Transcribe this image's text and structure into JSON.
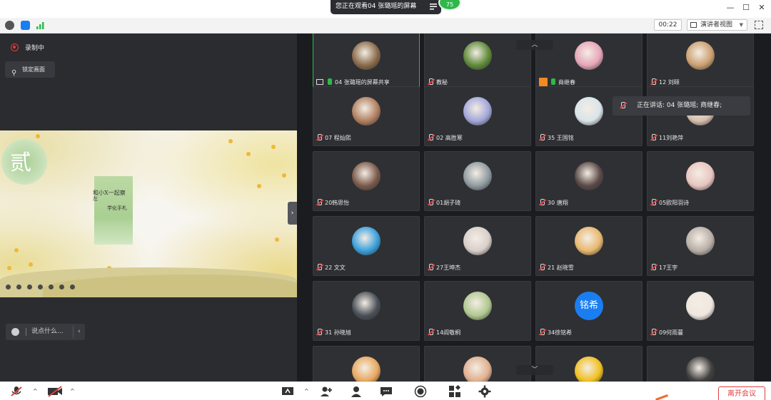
{
  "titlebar": {
    "share_banner": "您正在观看04 张璐瑶的屏幕",
    "participant_count": "75",
    "min": "—",
    "max": "☐",
    "close": "✕"
  },
  "toolbar": {
    "timer": "00:22",
    "view_mode": "演讲者视图",
    "view_caret": "▼"
  },
  "left": {
    "recording_label": "录制中",
    "lock_label": "锁定画面",
    "chat_placeholder": "说点什么...",
    "chat_arrow": "‹",
    "collapse_arrow": "›",
    "slide": {
      "big_char": "贰",
      "line1": "和小X一起察",
      "line1b": "左",
      "line2": "学化手札"
    }
  },
  "grid": {
    "scroll_up": "︿",
    "scroll_down": "﹀",
    "speaking_label": "正在讲话: 04 张璐瑶; 商继春;",
    "tiles": [
      {
        "name": "04 张璐瑶的屏幕共享",
        "avatar_color": "#8a6a4a",
        "mic": "on",
        "active": true,
        "screen": true
      },
      {
        "name": "教秘",
        "avatar_color": "#5f8a3a",
        "mic": "muted"
      },
      {
        "name": "商继春",
        "avatar_color": "#e6a6b8",
        "mic": "on",
        "badge": true
      },
      {
        "name": "12 刘颐",
        "avatar_color": "#caa070",
        "mic": "muted"
      },
      {
        "name": "07 程灿熙",
        "avatar_color": "#b08060",
        "mic": "muted"
      },
      {
        "name": "02 高胜寒",
        "avatar_color": "#a3a7d9",
        "mic": "muted"
      },
      {
        "name": "35 王国铭",
        "avatar_color": "#d9e4ea",
        "mic": "muted"
      },
      {
        "name": "11刘艳萍",
        "avatar_color": "#d8c0b0",
        "mic": "muted"
      },
      {
        "name": "20韩思怡",
        "avatar_color": "#7a5a4a",
        "mic": "muted"
      },
      {
        "name": "01胡子琦",
        "avatar_color": "#8f9aa0",
        "mic": "muted"
      },
      {
        "name": "30 唐翔",
        "avatar_color": "#5a4a48",
        "mic": "muted"
      },
      {
        "name": "05欧阳羽诗",
        "avatar_color": "#e8c6c0",
        "mic": "muted"
      },
      {
        "name": "22 文文",
        "avatar_color": "#3aa0dc",
        "mic": "muted"
      },
      {
        "name": "27王坤杰",
        "avatar_color": "#d8cfca",
        "mic": "muted"
      },
      {
        "name": "21 赵晓雪",
        "avatar_color": "#e8b870",
        "mic": "muted"
      },
      {
        "name": "17王宇",
        "avatar_color": "#b8b0a8",
        "mic": "muted"
      },
      {
        "name": "31 孙晓旭",
        "avatar_color": "#4a5058",
        "mic": "muted"
      },
      {
        "name": "14阎敬桐",
        "avatar_color": "#b0c890",
        "mic": "muted"
      },
      {
        "name": "34徐铭希",
        "avatar_color": "#1a7ef0",
        "avatar_text": "铭希",
        "mic": "muted"
      },
      {
        "name": "09何雨蔓",
        "avatar_color": "#f0e8e0",
        "mic": "muted"
      },
      {
        "name": "",
        "avatar_color": "#e8a860",
        "mic": "none"
      },
      {
        "name": "",
        "avatar_color": "#e0b090",
        "mic": "none"
      },
      {
        "name": "",
        "avatar_color": "#f0c020",
        "mic": "none"
      },
      {
        "name": "",
        "avatar_color": "#404040",
        "mic": "none"
      }
    ]
  },
  "bottombar": {
    "mic_icon": "🎤",
    "cam_icon": "📷",
    "caret": "^",
    "share_icon": "⬆",
    "invite_icon": "+",
    "members_icon": "●",
    "chat_icon": "▪",
    "record_icon": "◉",
    "apps_icon": "▦",
    "settings_icon": "⚙",
    "leave_label": "离开会议"
  },
  "colors": {
    "accent_green": "#2fb84a",
    "danger_red": "#e04040",
    "dark_bg": "#1b1c1f"
  }
}
